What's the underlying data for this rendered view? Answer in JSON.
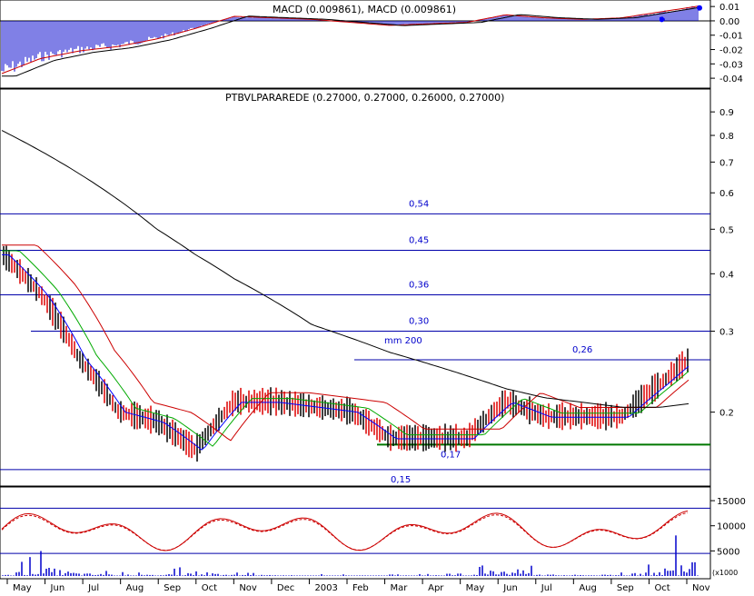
{
  "colors": {
    "frame": "#000000",
    "level_line": "#0000aa",
    "label_blue": "#0000cc",
    "price_bar_red": "#dd0000",
    "price_bar_black": "#000000",
    "ma_blue": "#0000ff",
    "ma_green": "#00aa00",
    "ma_red": "#cc0000",
    "ma200": "#000000",
    "macd_hist": "#0000cc",
    "volume": "#0000cc",
    "support_green": "#007700"
  },
  "months": [
    "May",
    "Jun",
    "Jul",
    "Aug",
    "Sep",
    "Oct",
    "Nov",
    "Dec",
    "2003",
    "Feb",
    "Mar",
    "Apr",
    "May",
    "Jun",
    "Jul",
    "Aug",
    "Sep",
    "Oct",
    "Nov"
  ],
  "chart_data": [
    {
      "panel": "macd",
      "type": "bar",
      "title": "MACD (0.009861), MACD (0.009861)",
      "ylim": [
        -0.045,
        0.012
      ],
      "y_ticks": [
        "0.01",
        "0.00",
        "-0.01",
        "-0.02",
        "-0.03",
        "-0.04"
      ],
      "x": [
        "May",
        "Jun",
        "Jul",
        "Aug",
        "Sep",
        "Oct",
        "Nov",
        "Dec",
        "2003",
        "Feb",
        "Mar",
        "Apr",
        "May",
        "Jun",
        "Jul",
        "Aug",
        "Sep",
        "Oct",
        "Nov"
      ],
      "series": [
        {
          "name": "MACD",
          "values": [
            -0.035,
            -0.025,
            -0.02,
            -0.017,
            -0.012,
            -0.005,
            0.003,
            0.002,
            0.001,
            -0.001,
            -0.003,
            -0.002,
            -0.001,
            0.004,
            0.002,
            0.001,
            0.002,
            0.006,
            0.0099
          ]
        }
      ],
      "markers": [
        {
          "x": "Oct",
          "value": 0.001
        },
        {
          "x": "Nov",
          "value": 0.009
        }
      ]
    },
    {
      "panel": "price",
      "type": "line",
      "title": "PTBVLPARAREDE (0.27000, 0.27000, 0.26000, 0.27000)",
      "scale": "log",
      "ylim": [
        0.14,
        1.0
      ],
      "y_ticks": [
        "0.9",
        "0.8",
        "0.7",
        "0.6",
        "0.5",
        "0.4",
        "0.3",
        "0.2"
      ],
      "x": [
        "May",
        "Jun",
        "Jul",
        "Aug",
        "Sep",
        "Oct",
        "Nov",
        "Dec",
        "2003",
        "Feb",
        "Mar",
        "Apr",
        "May",
        "Jun",
        "Jul",
        "Aug",
        "Sep",
        "Oct",
        "Nov"
      ],
      "series": [
        {
          "name": "close",
          "values": [
            0.44,
            0.36,
            0.26,
            0.2,
            0.19,
            0.165,
            0.21,
            0.21,
            0.205,
            0.2,
            0.175,
            0.175,
            0.175,
            0.21,
            0.195,
            0.195,
            0.195,
            0.23,
            0.27
          ]
        },
        {
          "name": "mm 200",
          "values": [
            0.82,
            0.74,
            0.66,
            0.58,
            0.5,
            0.44,
            0.39,
            0.35,
            0.31,
            0.29,
            0.27,
            0.255,
            0.24,
            0.225,
            0.215,
            0.21,
            0.205,
            0.205,
            0.21
          ]
        }
      ],
      "levels": [
        {
          "value": 0.54,
          "label": "0,54"
        },
        {
          "value": 0.45,
          "label": "0,45"
        },
        {
          "value": 0.36,
          "label": "0,36"
        },
        {
          "value": 0.3,
          "label": "0,30"
        },
        {
          "value": 0.26,
          "label": "0,26"
        },
        {
          "value": 0.17,
          "label": "0,17"
        },
        {
          "value": 0.15,
          "label": "0,15"
        }
      ],
      "annotations": [
        "mm 200"
      ]
    },
    {
      "panel": "volume",
      "type": "bar",
      "units": "x1000",
      "units_label": "(x1000",
      "ylim": [
        0,
        17000
      ],
      "y_ticks": [
        "15000",
        "10000",
        "5000"
      ],
      "levels": [
        13500,
        4500
      ],
      "x": [
        "May",
        "Jun",
        "Jul",
        "Aug",
        "Sep",
        "Oct",
        "Nov",
        "Dec",
        "2003",
        "Feb",
        "Mar",
        "Apr",
        "May",
        "Jun",
        "Jul",
        "Aug",
        "Sep",
        "Oct",
        "Nov"
      ],
      "series": [
        {
          "name": "volume",
          "values": [
            500,
            5000,
            1500,
            800,
            600,
            2500,
            700,
            500,
            400,
            300,
            300,
            400,
            500,
            4500,
            800,
            600,
            700,
            3000,
            16000
          ]
        }
      ]
    }
  ]
}
